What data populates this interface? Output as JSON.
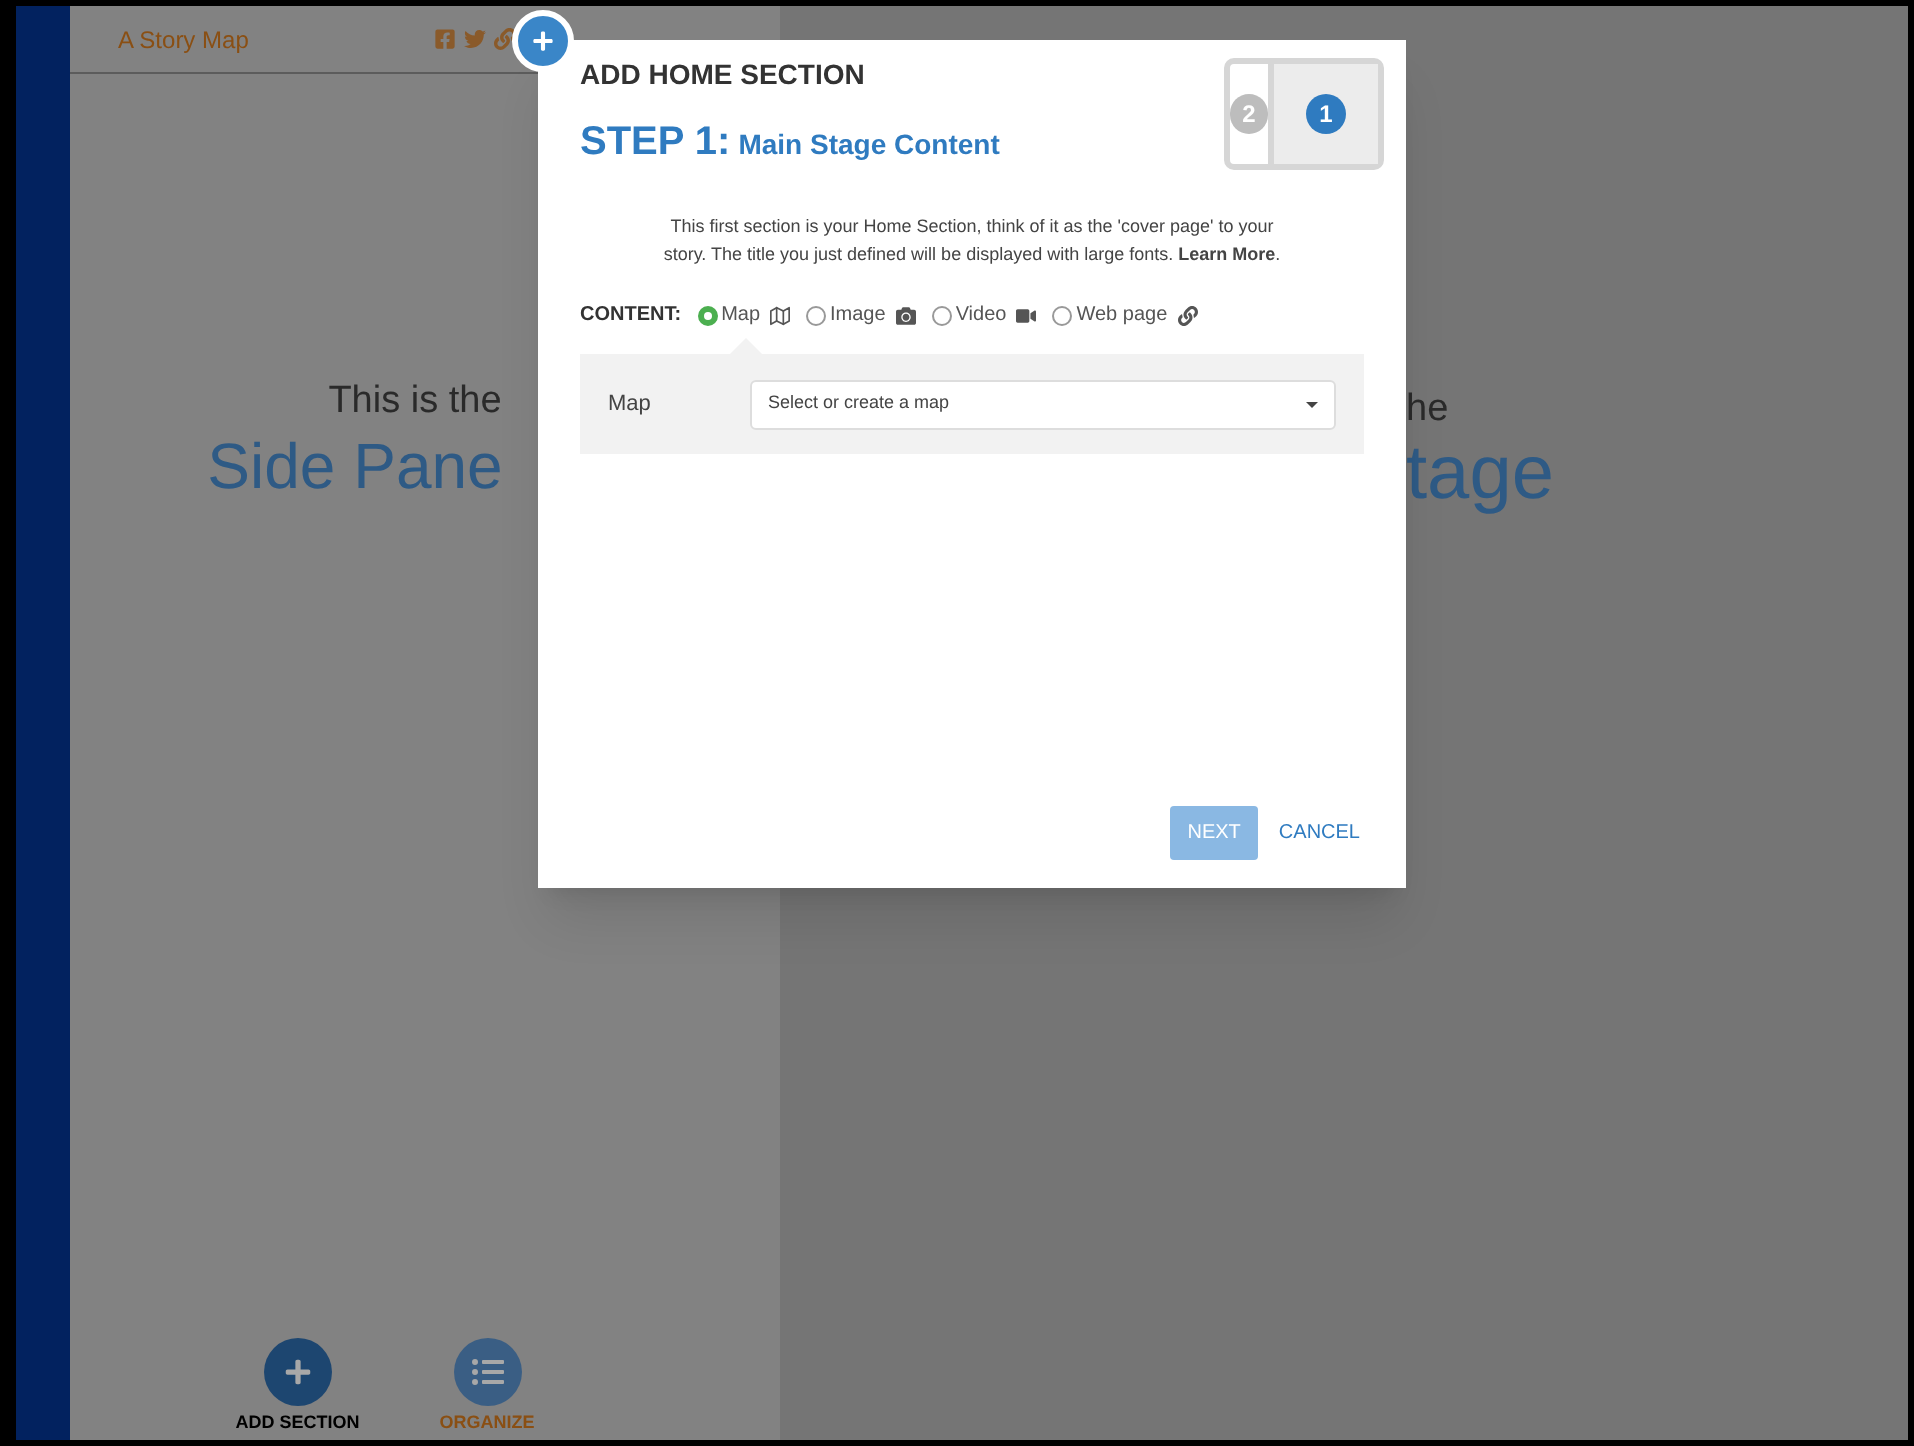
{
  "side_panel": {
    "header_title": "A Story Map",
    "intro": "This is the",
    "title": "Side Pane",
    "actions": [
      {
        "label": "ADD SECTION",
        "kind": "add"
      },
      {
        "label": "ORGANIZE",
        "kind": "organize"
      }
    ]
  },
  "main_stage": {
    "intro": "he",
    "title": "tage"
  },
  "dialog": {
    "title": "ADD HOME SECTION",
    "step_label": "STEP 1:",
    "step_title": "Main Stage Content",
    "steps": [
      {
        "number": "2",
        "selected": false
      },
      {
        "number": "1",
        "selected": true
      }
    ],
    "description": "This first section is your Home Section, think of it as the 'cover page' to your story. The title you just defined will be displayed with large fonts. **Learn More**.",
    "content_label": "CONTENT:",
    "content_options": [
      {
        "label": "Map",
        "kind": "map",
        "selected": true
      },
      {
        "label": "Image",
        "kind": "image",
        "selected": false
      },
      {
        "label": "Video",
        "kind": "video",
        "selected": false
      },
      {
        "label": "Web page",
        "kind": "web",
        "selected": false
      }
    ],
    "map_field": {
      "label": "Map",
      "placeholder": "Select or create a map"
    },
    "buttons": [
      {
        "label": "NEXT",
        "kind": "primary"
      },
      {
        "label": "CANCEL",
        "kind": "link"
      }
    ]
  }
}
